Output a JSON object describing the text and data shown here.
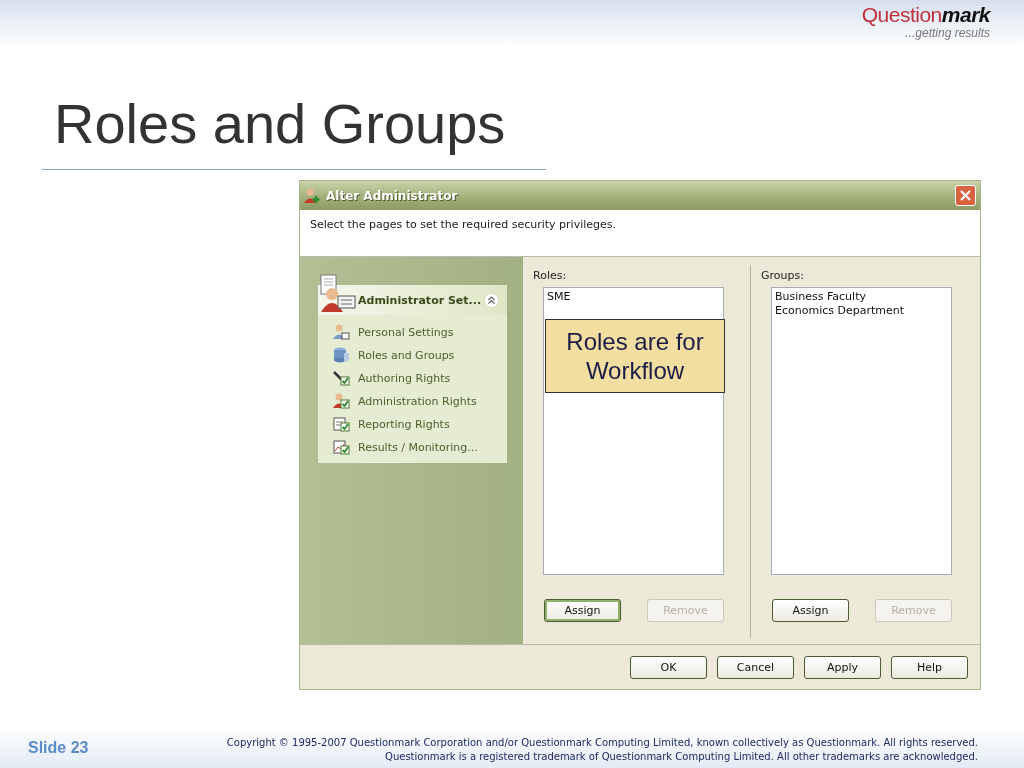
{
  "logo": {
    "brand": "Question",
    "brand_bold": "mark",
    "tagline": "...getting results"
  },
  "title": "Roles and Groups",
  "dialog": {
    "title": "Alter Administrator",
    "instruction": "Select the pages to set the required security privileges.",
    "task_panel": {
      "title": "Administrator Set...",
      "expanded": true,
      "items": [
        {
          "label": "Personal Settings"
        },
        {
          "label": "Roles and Groups"
        },
        {
          "label": "Authoring Rights"
        },
        {
          "label": "Administration Rights"
        },
        {
          "label": "Reporting Rights"
        },
        {
          "label": "Results / Monitoring..."
        }
      ]
    },
    "roles": {
      "label": "Roles:",
      "items": [
        "SME"
      ],
      "buttons": [
        {
          "label": "Assign",
          "disabled": false,
          "focused": true
        },
        {
          "label": "Remove",
          "disabled": true,
          "focused": false
        }
      ]
    },
    "groups": {
      "label": "Groups:",
      "items": [
        "Business Faculty",
        "Economics Department"
      ],
      "buttons": [
        {
          "label": "Assign",
          "disabled": false,
          "focused": false
        },
        {
          "label": "Remove",
          "disabled": true,
          "focused": false
        }
      ]
    },
    "buttons": [
      {
        "label": "OK"
      },
      {
        "label": "Cancel"
      },
      {
        "label": "Apply"
      },
      {
        "label": "Help"
      }
    ],
    "callout": "Roles are for Workflow"
  },
  "footer": {
    "slide": "Slide 23",
    "copyright": [
      "Copyright © 1995-2007 Questionmark Corporation and/or Questionmark Computing Limited, known collectively as Questionmark. All rights reserved.",
      "Questionmark is a registered trademark of Questionmark Computing Limited. All other trademarks are acknowledged."
    ]
  }
}
